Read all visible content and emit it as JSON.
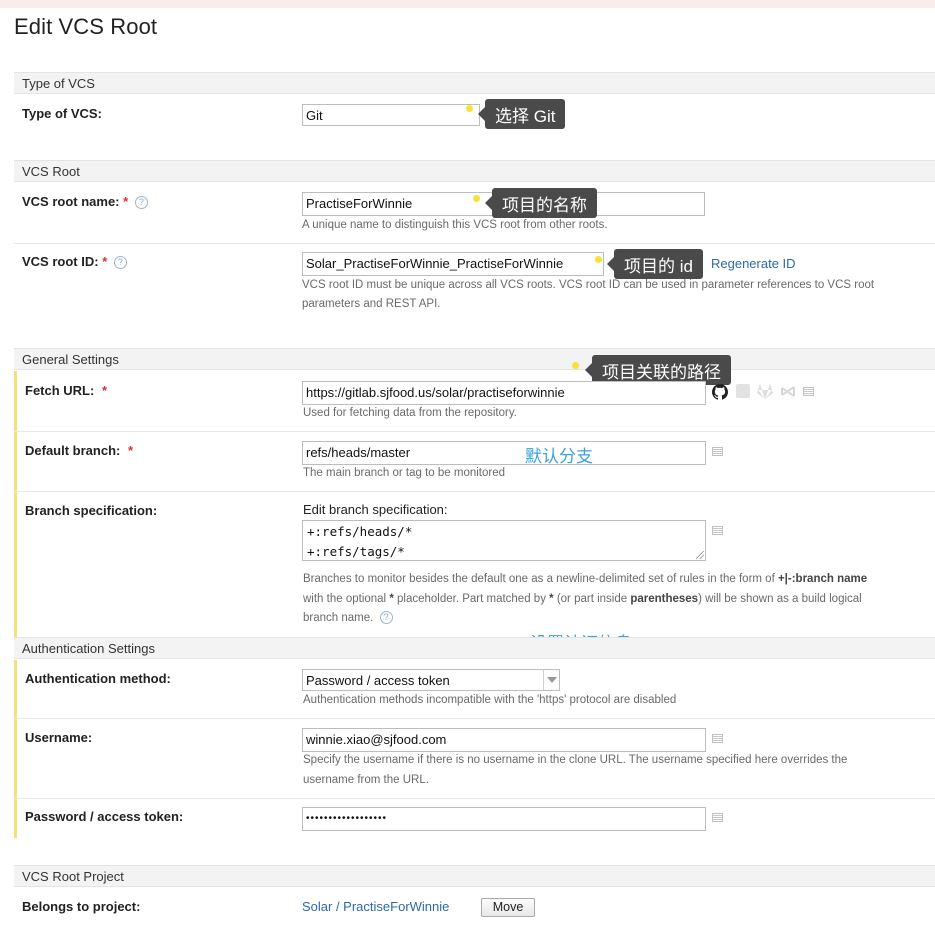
{
  "page": {
    "title": "Edit VCS Root"
  },
  "sections": {
    "type_of_vcs": "Type of VCS",
    "vcs_root": "VCS Root",
    "general_settings": "General Settings",
    "authentication_settings": "Authentication Settings",
    "vcs_root_project": "VCS Root Project"
  },
  "fields": {
    "type_of_vcs": {
      "label": "Type of VCS:",
      "value": "Git"
    },
    "vcs_root_name": {
      "label": "VCS root name:",
      "required": "*",
      "value": "PractiseForWinnie",
      "hint": "A unique name to distinguish this VCS root from other roots."
    },
    "vcs_root_id": {
      "label": "VCS root ID:",
      "required": "*",
      "value": "Solar_PractiseForWinnie_PractiseForWinnie",
      "link": "Regenerate ID",
      "hint_line1": "VCS root ID must be unique across all VCS roots. VCS root ID can be used in parameter references to VCS root",
      "hint_line2": "parameters and REST API."
    },
    "fetch_url": {
      "label": "Fetch URL:",
      "required": "*",
      "value": "https://gitlab.sjfood.us/solar/practiseforwinnie",
      "hint": "Used for fetching data from the repository."
    },
    "default_branch": {
      "label": "Default branch:",
      "required": "*",
      "value": "refs/heads/master",
      "hint": "The main branch or tag to be monitored"
    },
    "branch_spec": {
      "label": "Branch specification:",
      "edit_label": "Edit branch specification:",
      "lines": [
        "+:refs/heads/*",
        "+:refs/tags/*"
      ],
      "hint_line1_a": "Branches to monitor besides the default one as a newline-delimited set of rules in the form of ",
      "hint_line1_b": "+|-:branch name",
      "hint_line2_a": "with the optional ",
      "hint_line2_b": "*",
      "hint_line2_c": " placeholder. Part matched by ",
      "hint_line2_d": "*",
      "hint_line2_e": " (or part inside ",
      "hint_line2_f": "parentheses",
      "hint_line2_g": ") will be shown as a build logical",
      "hint_line3": "branch name."
    },
    "auth_method": {
      "label": "Authentication method:",
      "value": "Password / access token",
      "hint": "Authentication methods incompatible with the 'https' protocol are disabled"
    },
    "username": {
      "label": "Username:",
      "value": "winnie.xiao@sjfood.com",
      "hint_line1": "Specify the username if there is no username in the clone URL. The username specified here overrides the",
      "hint_line2": "username from the URL."
    },
    "password": {
      "label": "Password / access token:",
      "value": "••••••••••••••••••"
    },
    "project": {
      "label": "Belongs to project:",
      "link": "Solar / PractiseForWinnie",
      "button": "Move"
    }
  },
  "annotations": {
    "select_git": "选择 Git",
    "project_name": "项目的名称",
    "project_id": "项目的 id",
    "project_path": "项目关联的路径",
    "default_branch": "默认分支",
    "auth_info": "设置认证信息"
  },
  "icons": {
    "help": "?",
    "github": "github-icon"
  },
  "colors": {
    "link": "#2a6aa8",
    "required": "#e03030",
    "tooltip_bg": "#4a4a4a",
    "annotation_blue": "#3aa3dc",
    "highlight_dot": "#f7e13a",
    "section_bg": "#f3f3f3"
  }
}
